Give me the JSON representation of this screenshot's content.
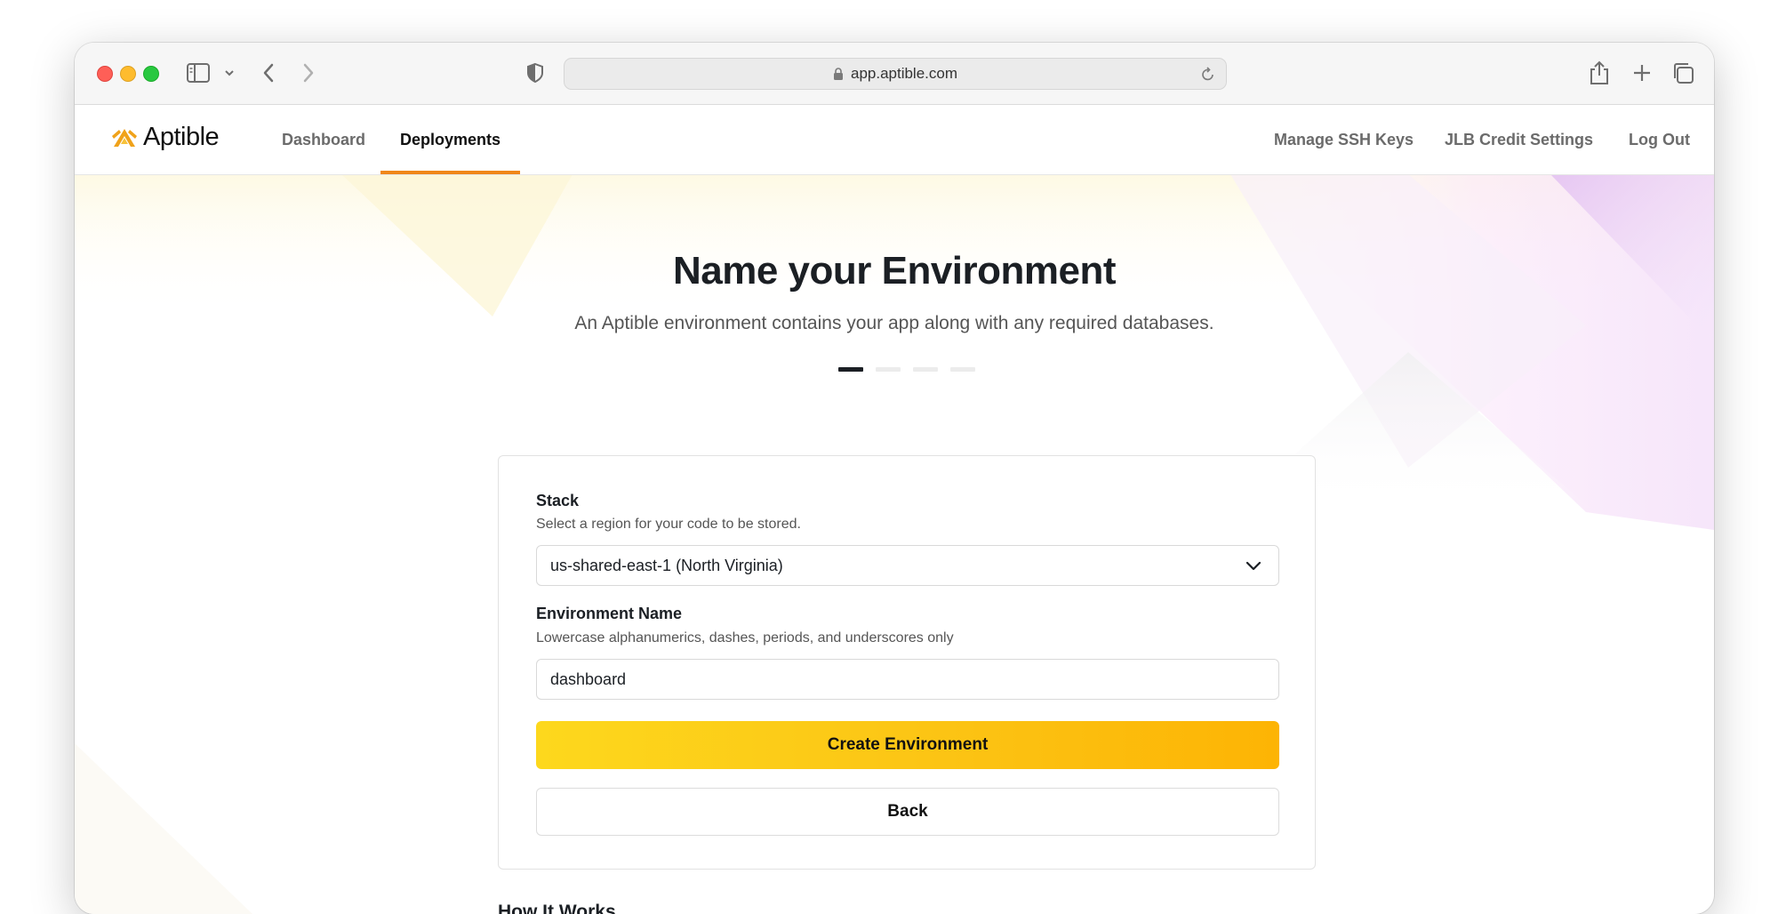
{
  "browser": {
    "url": "app.aptible.com"
  },
  "nav": {
    "logo_text": "Aptible",
    "links": [
      {
        "label": "Dashboard"
      },
      {
        "label": "Deployments"
      }
    ],
    "right_links": [
      {
        "label": "Manage SSH Keys"
      },
      {
        "label": "JLB Credit Settings"
      },
      {
        "label": "Log Out"
      }
    ],
    "active": "Deployments"
  },
  "page": {
    "title": "Name your Environment",
    "subtitle": "An Aptible environment contains your app along with any required databases.",
    "steps_total": 4,
    "step_current": 1
  },
  "form": {
    "stack": {
      "label": "Stack",
      "help": "Select a region for your code to be stored.",
      "value": "us-shared-east-1 (North Virginia)"
    },
    "env_name": {
      "label": "Environment Name",
      "help": "Lowercase alphanumerics, dashes, periods, and underscores only",
      "value": "dashboard"
    },
    "create_label": "Create Environment",
    "back_label": "Back"
  },
  "section": {
    "how_it_works": "How It Works"
  },
  "colors": {
    "accent": "#f0871a",
    "button_start": "#fdd81d",
    "button_end": "#fdb404"
  }
}
